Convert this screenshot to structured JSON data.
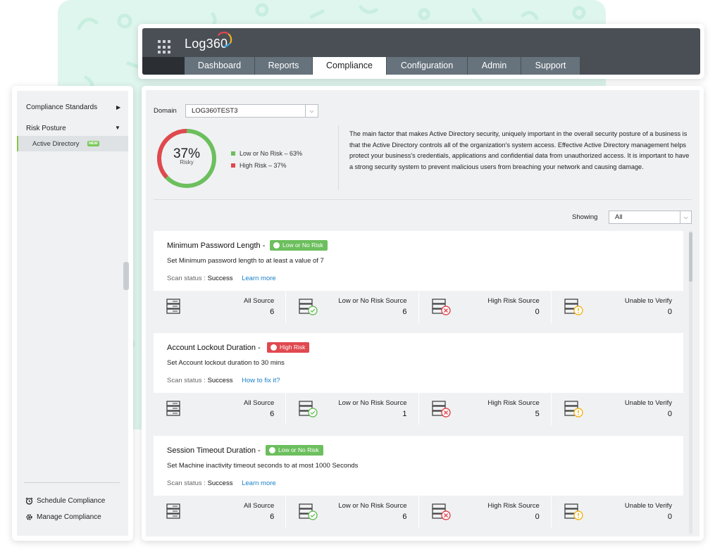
{
  "header": {
    "logo": "Log360",
    "tabs": [
      {
        "label": "Dashboard"
      },
      {
        "label": "Reports"
      },
      {
        "label": "Compliance"
      },
      {
        "label": "Configuration"
      },
      {
        "label": "Admin"
      },
      {
        "label": "Support"
      }
    ]
  },
  "sidebar": {
    "compliance_standards": "Compliance Standards",
    "risk_posture": "Risk Posture",
    "active_directory": "Active Directory",
    "new_badge": "NEW",
    "schedule": "Schedule Compliance",
    "manage": "Manage Compliance"
  },
  "main": {
    "domain_label": "Domain",
    "domain_value": "LOG360TEST3",
    "risk_percent": "37%",
    "risk_label": "Risky",
    "risky_fraction": 0.37,
    "legend": [
      {
        "label": "Low or No Risk – 63%",
        "color": "#6cbf5d"
      },
      {
        "label": "High Risk – 37%",
        "color": "#e0494f"
      }
    ],
    "description": "The main factor that makes Active Directory security, uniquely important in the overall security posture of a business is that the Active Directory controls all of the organization's system access. Effective Active Directory management helps protect your business's credentials, applications and confidential data from unauthorized access. It is important to have a strong security system to prevent malicious users from breaching your network and causing damage.",
    "showing_label": "Showing",
    "showing_value": "All"
  },
  "stat_labels": {
    "all": "All Source",
    "low": "Low or No Risk Source",
    "high": "High Risk Source",
    "unable": "Unable to Verify"
  },
  "cards": [
    {
      "title": "Minimum Password Length -",
      "status": "Low or No Risk",
      "description": "Set Minimum password length to at least a value of 7",
      "scan_label": "Scan status :",
      "scan_status": "Success",
      "link": "Learn more",
      "all": "6",
      "low": "6",
      "high": "0",
      "unable": "0"
    },
    {
      "title": "Account Lockout Duration -",
      "status": "High Risk",
      "description": "Set Account lockout duration to 30 mins",
      "scan_label": "Scan status :",
      "scan_status": "Success",
      "link": "How to fix it?",
      "all": "6",
      "low": "1",
      "high": "5",
      "unable": "0"
    },
    {
      "title": "Session Timeout Duration -",
      "status": "Low or No Risk",
      "description": "Set Machine inactivity timeout seconds to at most 1000 Seconds",
      "scan_label": "Scan status :",
      "scan_status": "Success",
      "link": "Learn more",
      "all": "6",
      "low": "6",
      "high": "0",
      "unable": "0"
    }
  ],
  "colors": {
    "low": "#6cbf5d",
    "high": "#e0494f",
    "warn": "#f3b61f",
    "link": "#1a7fc7"
  }
}
